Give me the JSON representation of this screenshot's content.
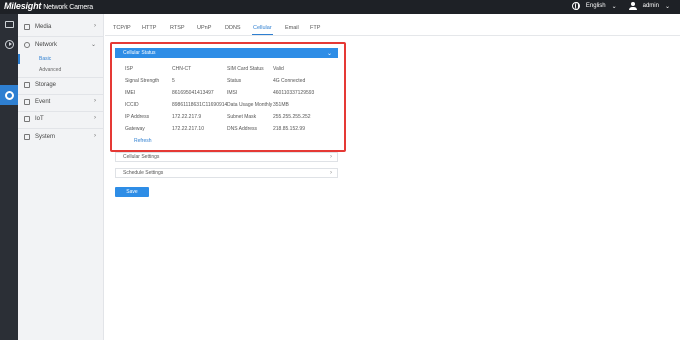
{
  "header": {
    "brand": "Milesight",
    "product": "Network Camera",
    "language": "English",
    "user": "admin"
  },
  "menu": {
    "items": [
      {
        "label": "Media"
      },
      {
        "label": "Network"
      },
      {
        "label": "Storage"
      },
      {
        "label": "Event"
      },
      {
        "label": "IoT"
      },
      {
        "label": "System"
      }
    ],
    "network_sub": [
      {
        "label": "Basic"
      },
      {
        "label": "Advanced"
      }
    ]
  },
  "tabs": [
    {
      "label": "TCP/IP"
    },
    {
      "label": "HTTP"
    },
    {
      "label": "RTSP"
    },
    {
      "label": "UPnP"
    },
    {
      "label": "DDNS"
    },
    {
      "label": "Cellular"
    },
    {
      "label": "Email"
    },
    {
      "label": "FTP"
    }
  ],
  "cellular_status": {
    "title": "Cellular Status",
    "rows": [
      {
        "l1": "ISP",
        "v1": "CHN-CT",
        "l2": "SIM Card Status",
        "v2": "Valid"
      },
      {
        "l1": "Signal Strength",
        "v1": "5",
        "l2": "Status",
        "v2": "4G Connected"
      },
      {
        "l1": "IMEI",
        "v1": "861695041413497",
        "l2": "IMSI",
        "v2": "460110337129593"
      },
      {
        "l1": "ICCID",
        "v1": "89861118631C11690914",
        "l2": "Data Usage Monthly",
        "v2": "351MB"
      },
      {
        "l1": "IP Address",
        "v1": "172.22.217.9",
        "l2": "Subnet Mask",
        "v2": "255.255.255.252"
      },
      {
        "l1": "Gateway",
        "v1": "172.22.217.10",
        "l2": "DNS Address",
        "v2": "218.85.152.99"
      }
    ],
    "refresh": "Refresh"
  },
  "panels": {
    "cellular_settings": "Cellular Settings",
    "schedule_settings": "Schedule Settings"
  },
  "save_label": "Save",
  "colors": {
    "accent": "#2e8de6",
    "topbar": "#1e2126",
    "rail": "#2b2f36",
    "highlight": "#e53935"
  }
}
